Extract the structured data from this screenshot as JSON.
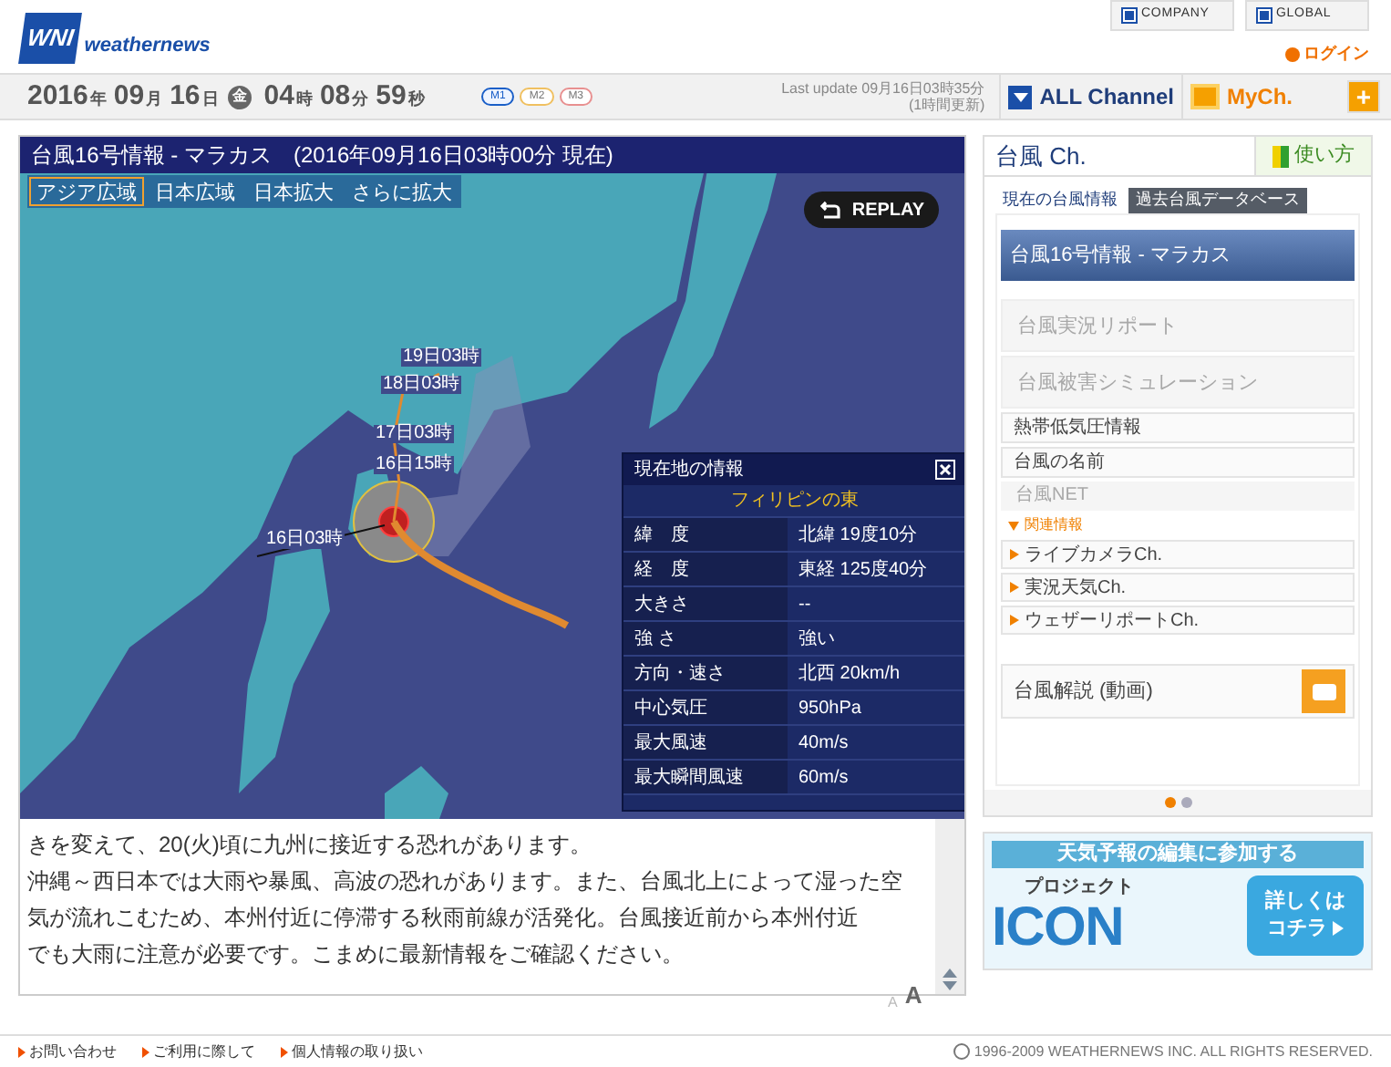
{
  "header": {
    "logo_mark": "WNI",
    "logo_text": "weathernews",
    "links": [
      "COMPANY",
      "GLOBAL"
    ],
    "login": "ログイン"
  },
  "datebar": {
    "date": [
      {
        "kind": "num",
        "text": "2016"
      },
      {
        "kind": "unit",
        "text": "年"
      },
      {
        "kind": "num",
        "text": "09"
      },
      {
        "kind": "unit",
        "text": "月"
      },
      {
        "kind": "num",
        "text": "16"
      },
      {
        "kind": "unit",
        "text": "日"
      },
      {
        "kind": "weekday",
        "text": "金"
      },
      {
        "kind": "num",
        "text": "04"
      },
      {
        "kind": "unit",
        "text": "時"
      },
      {
        "kind": "num",
        "text": "08"
      },
      {
        "kind": "unit",
        "text": "分"
      },
      {
        "kind": "num",
        "text": "59"
      },
      {
        "kind": "unit",
        "text": "秒"
      }
    ],
    "modes": [
      {
        "label": "M1",
        "selected": true,
        "color": "#1a5fc8"
      },
      {
        "label": "M2",
        "selected": false,
        "color": "#f0c060"
      },
      {
        "label": "M3",
        "selected": false,
        "color": "#e89090"
      }
    ],
    "last_update": "Last update  09月16日03時35分",
    "update_interval": "(1時間更新)",
    "all_channel": "ALL Channel",
    "mych": "MyCh.",
    "add": "+"
  },
  "map_panel": {
    "title": "台風16号情報 - マラカス　(2016年09月16日03時00分 現在)",
    "tabs": [
      {
        "label": "アジア広域",
        "selected": true
      },
      {
        "label": "日本広域",
        "selected": false
      },
      {
        "label": "日本拡大",
        "selected": false
      },
      {
        "label": "さらに拡大",
        "selected": false
      }
    ],
    "replay": "REPLAY",
    "track_labels": [
      "19日03時",
      "18日03時",
      "17日03時",
      "16日15時",
      "16日03時"
    ],
    "info": {
      "title": "現在地の情報",
      "location": "フィリピンの東",
      "rows": [
        {
          "label": "緯　度",
          "value": "北緯  19度10分"
        },
        {
          "label": "経　度",
          "value": "東経 125度40分"
        },
        {
          "label": "大きさ",
          "value": "--"
        },
        {
          "label": "強 さ",
          "value": "強い"
        },
        {
          "label": "方向・速さ",
          "value": "北西  20km/h"
        },
        {
          "label": "中心気圧",
          "value": "950hPa"
        },
        {
          "label": "最大風速",
          "value": "40m/s"
        },
        {
          "label": "最大瞬間風速",
          "value": "60m/s"
        }
      ]
    },
    "text_lines": [
      "きを変えて、20(火)頃に九州に接近する恐れがあります。",
      "沖縄～西日本では大雨や暴風、高波の恐れがあります。また、台風北上によって湿った空",
      "気が流れこむため、本州付近に停滞する秋雨前線が活発化。台風接近前から本州付近",
      "でも大雨に注意が必要です。こまめに最新情報をご確認ください。"
    ],
    "font_small": "A",
    "font_large": "A"
  },
  "side_panel": {
    "title": "台風 Ch.",
    "help": "使い方",
    "tabs": [
      {
        "label": "現在の台風情報",
        "selected": true
      },
      {
        "label": "過去台風データベース",
        "selected": false
      }
    ],
    "items": [
      {
        "kind": "large",
        "label": "台風16号情報 - マラカス",
        "selected": true
      },
      {
        "kind": "disabled",
        "label": "台風実況リポート"
      },
      {
        "kind": "disabled",
        "label": "台風被害シミュレーション"
      },
      {
        "kind": "normal",
        "label": "熱帯低気圧情報"
      },
      {
        "kind": "normal",
        "label": "台風の名前"
      },
      {
        "kind": "disabled_small",
        "label": "台風NET"
      },
      {
        "kind": "section",
        "label": "関連情報"
      },
      {
        "kind": "link",
        "label": "ライブカメラCh."
      },
      {
        "kind": "link",
        "label": "実況天気Ch."
      },
      {
        "kind": "link",
        "label": "ウェザーリポートCh."
      },
      {
        "kind": "video",
        "label": "台風解説 (動画)"
      }
    ],
    "pages": [
      {
        "selected": true
      },
      {
        "selected": false
      }
    ]
  },
  "banner": {
    "headline": "天気予報の編集に参加する",
    "project": "プロジェクト",
    "logo": "ICON",
    "cta_line1": "詳しくは",
    "cta_line2": "コチラ"
  },
  "footer": {
    "links": [
      "お問い合わせ",
      "ご利用に際して",
      "個人情報の取り扱い"
    ],
    "copyright": "1996-2009 WEATHERNEWS INC. ALL RIGHTS RESERVED."
  }
}
